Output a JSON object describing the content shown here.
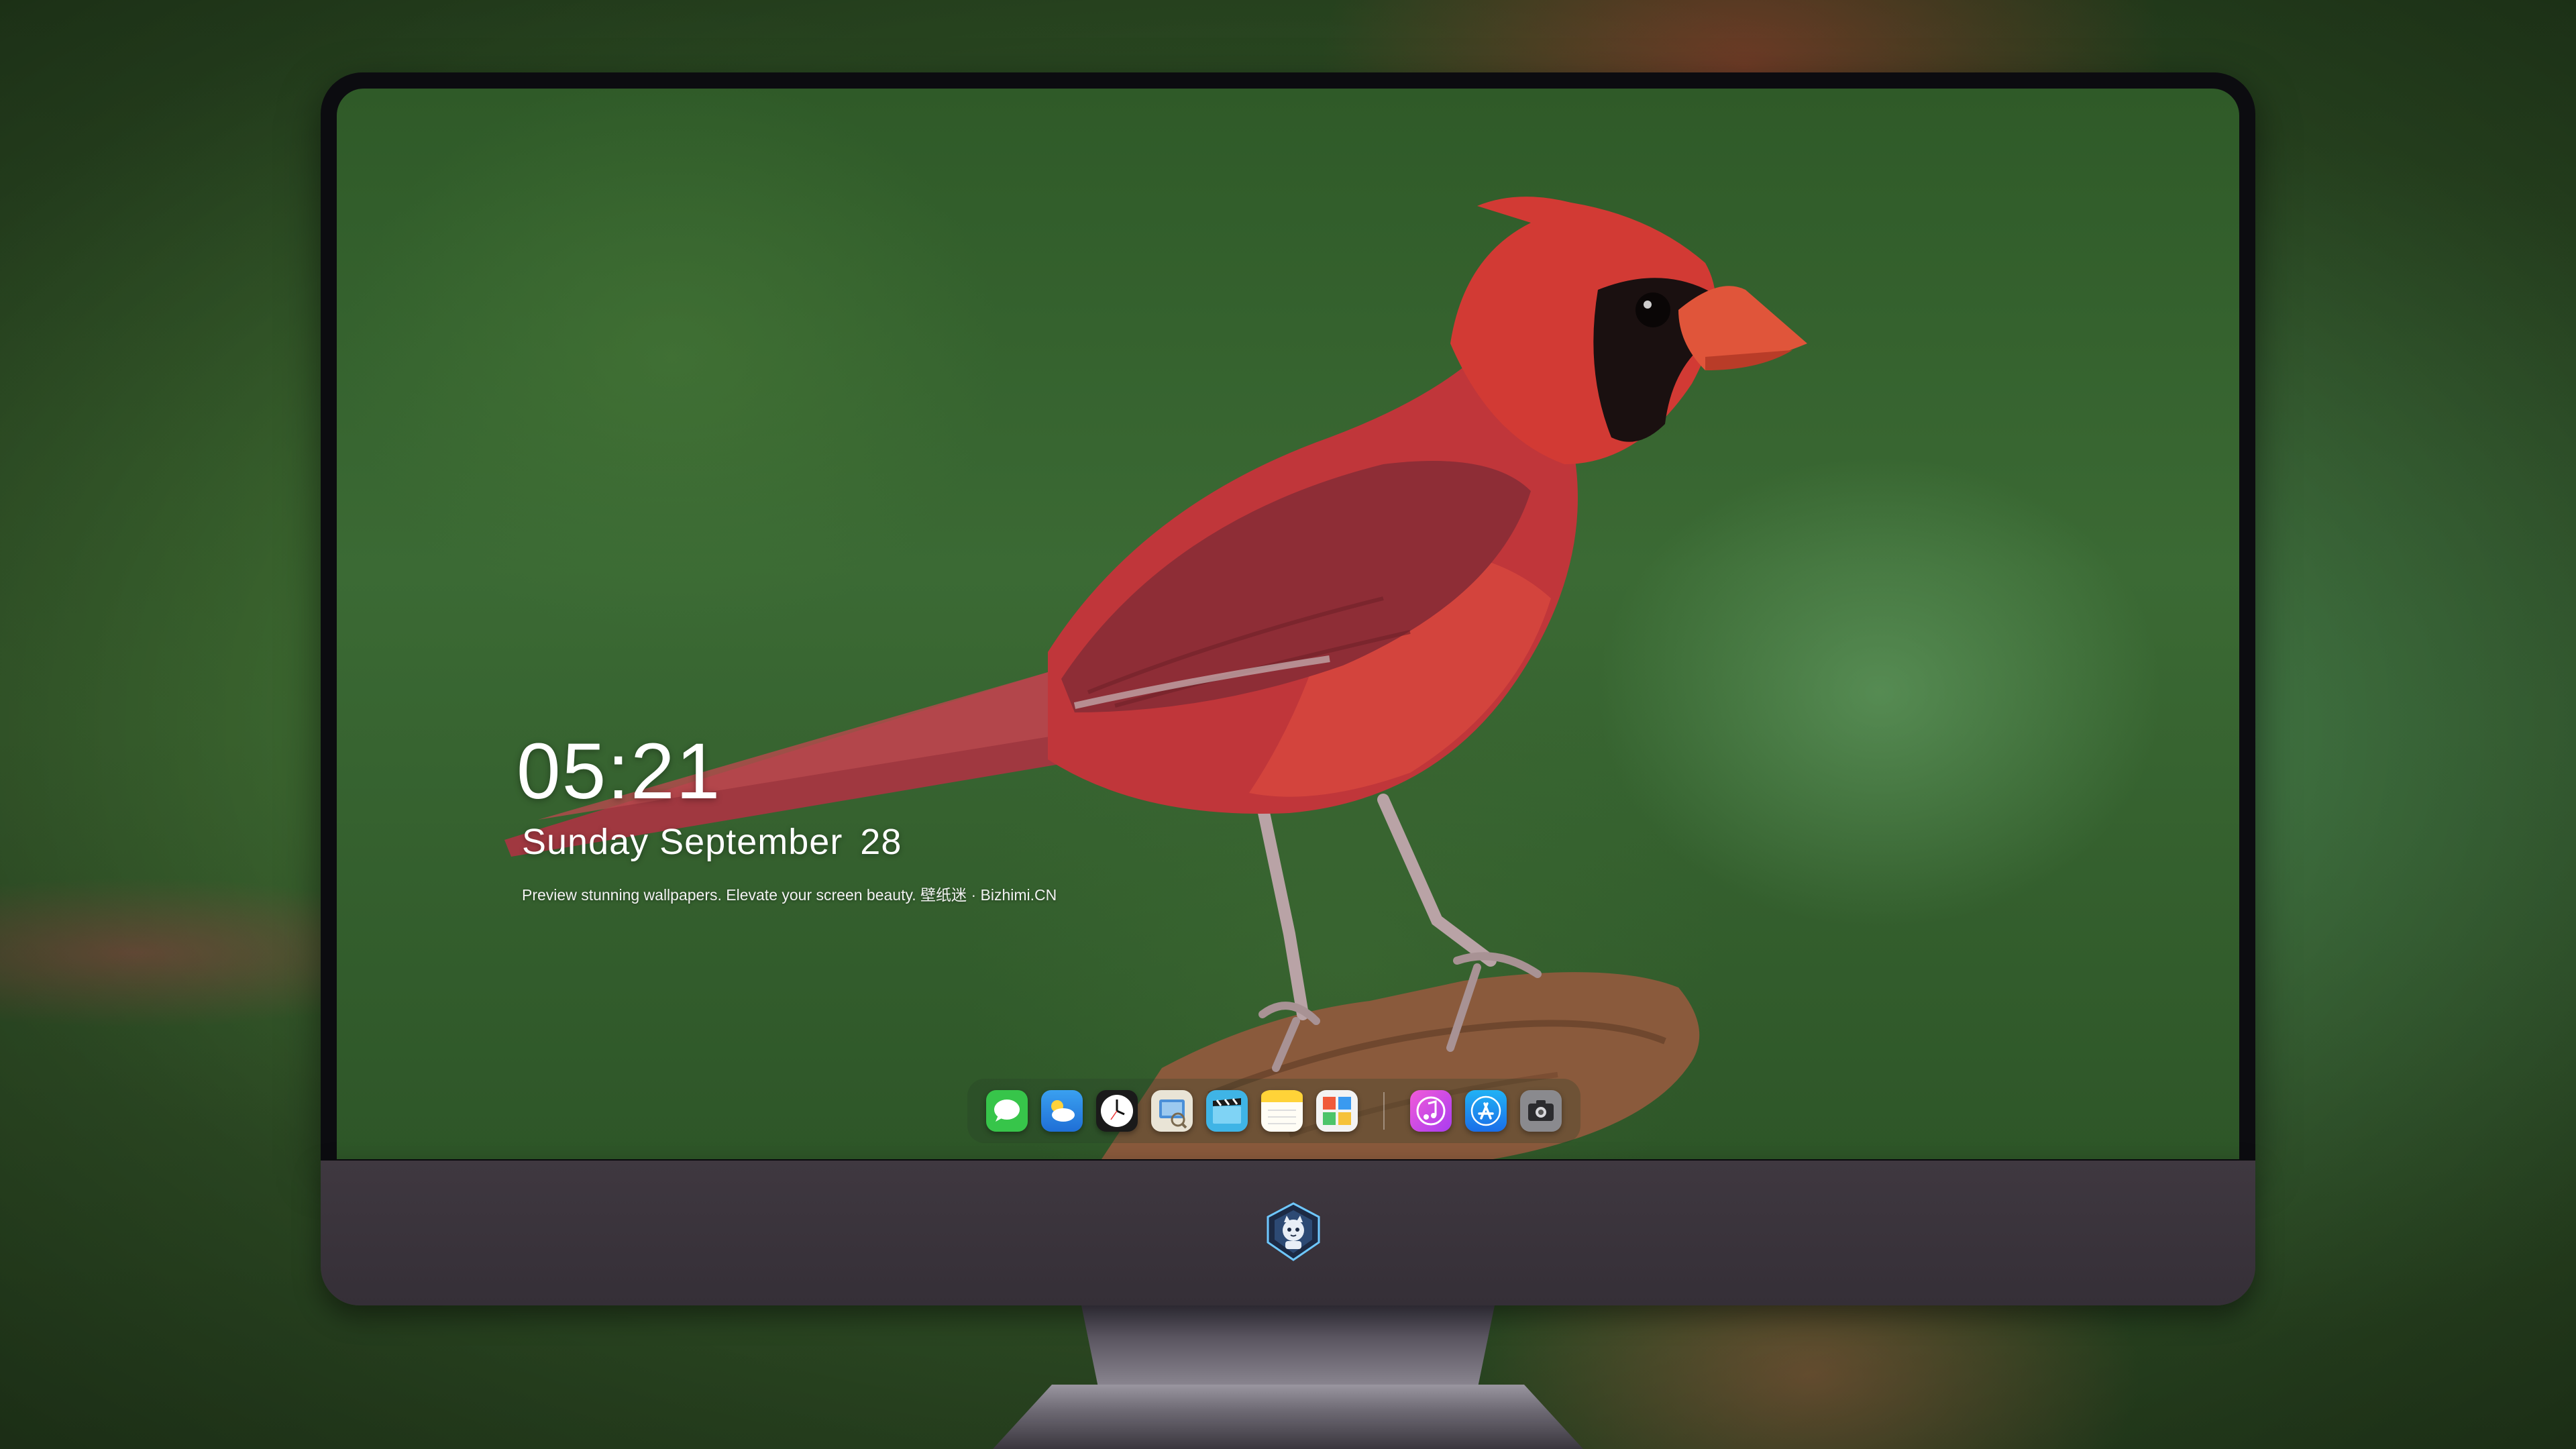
{
  "lockscreen": {
    "time": "05:21",
    "weekday_month": "Sunday September",
    "day": "28",
    "tagline": "Preview stunning wallpapers. Elevate your screen beauty. 壁纸迷 · Bizhimi.CN"
  },
  "dock": {
    "apps": [
      {
        "name": "messages-icon"
      },
      {
        "name": "weather-icon"
      },
      {
        "name": "clock-icon"
      },
      {
        "name": "preview-icon"
      },
      {
        "name": "clips-icon"
      },
      {
        "name": "notes-icon"
      },
      {
        "name": "photo-booth-icon"
      }
    ],
    "pinned": [
      {
        "name": "music-icon"
      },
      {
        "name": "app-store-icon"
      },
      {
        "name": "screenshot-icon"
      }
    ]
  },
  "colors": {
    "bird_red": "#c8332e",
    "background_green": "#3b6a34",
    "monitor_chin": "#3a333c"
  }
}
